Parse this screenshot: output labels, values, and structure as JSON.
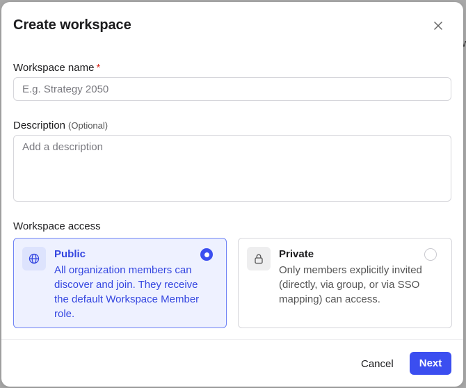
{
  "modal": {
    "title": "Create workspace"
  },
  "form": {
    "name": {
      "label": "Workspace name",
      "required_mark": "*",
      "placeholder": "E.g. Strategy 2050",
      "value": ""
    },
    "description": {
      "label": "Description",
      "optional_note": "(Optional)",
      "placeholder": "Add a description",
      "value": ""
    },
    "access": {
      "label": "Workspace access",
      "selected": "public",
      "options": [
        {
          "id": "public",
          "icon": "globe-icon",
          "title": "Public",
          "description": "All organization members can discover and join. They receive the default Workspace Member role."
        },
        {
          "id": "private",
          "icon": "lock-icon",
          "title": "Private",
          "description": "Only members explicitly invited (directly, via group, or via SSO mapping) can access."
        }
      ]
    }
  },
  "footer": {
    "cancel_label": "Cancel",
    "next_label": "Next"
  },
  "background": {
    "peek_text": "w"
  },
  "colors": {
    "accent": "#3b4ef0",
    "accent_text": "#3446e0",
    "selected_bg": "#eef1ff",
    "required": "#d92d20"
  }
}
